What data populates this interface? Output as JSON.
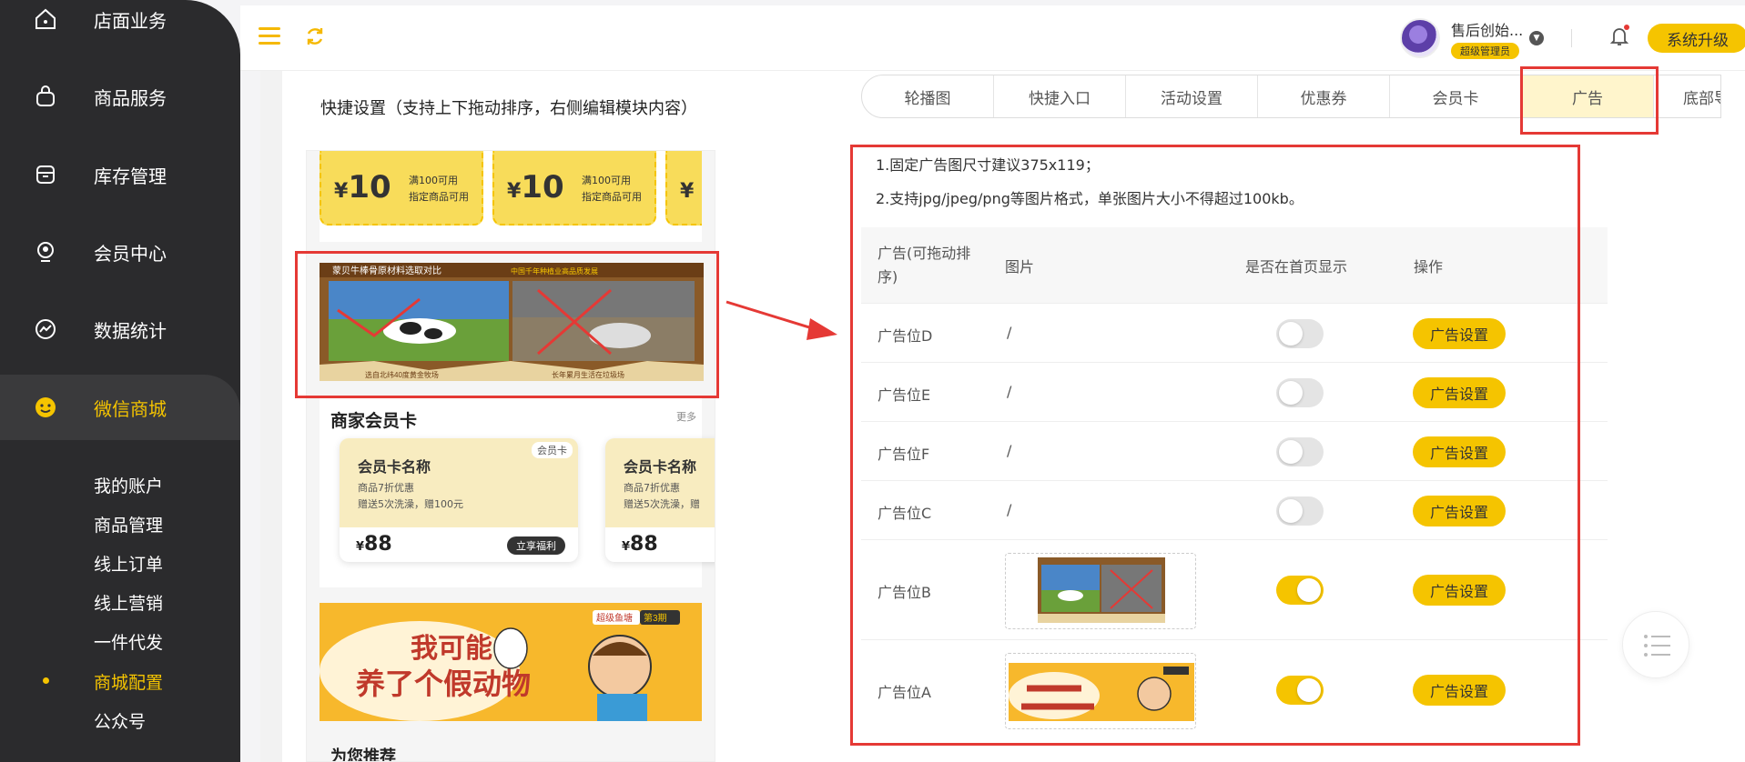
{
  "sidebar": {
    "items": [
      {
        "label": "店面业务",
        "icon": "home-icon"
      },
      {
        "label": "商品服务",
        "icon": "bag-icon"
      },
      {
        "label": "库存管理",
        "icon": "box-icon"
      },
      {
        "label": "会员中心",
        "icon": "member-icon"
      },
      {
        "label": "数据统计",
        "icon": "chart-icon"
      },
      {
        "label": "微信商城",
        "icon": "smile-icon",
        "active": true
      }
    ],
    "sub_items": [
      {
        "label": "我的账户"
      },
      {
        "label": "商品管理"
      },
      {
        "label": "线上订单"
      },
      {
        "label": "线上营销"
      },
      {
        "label": "一件代发"
      },
      {
        "label": "商城配置",
        "active": true
      },
      {
        "label": "公众号"
      }
    ]
  },
  "header": {
    "user_name": "售后创始...",
    "user_role": "超级管理员",
    "upgrade_label": "系统升级"
  },
  "preview": {
    "title": "快捷设置（支持上下拖动排序，右侧编辑模块内容）",
    "coupons": [
      {
        "symbol": "¥",
        "amount": "10",
        "line1": "满100可用",
        "line2": "指定商品可用"
      },
      {
        "symbol": "¥",
        "amount": "10",
        "line1": "满100可用",
        "line2": "指定商品可用"
      },
      {
        "symbol": "¥",
        "amount": "",
        "line1": "",
        "line2": ""
      }
    ],
    "ad_banner": {
      "title": "蒙贝牛棒骨原材料选取对比",
      "subtitle": "中国千年种植业高品质发展",
      "caption_left": "选自北纬40度黄金牧场",
      "caption_right": "长年累月生活在垃圾场"
    },
    "member_section": {
      "title": "商家会员卡",
      "more": "更多",
      "cards": [
        {
          "tag": "会员卡",
          "name": "会员卡名称",
          "line1": "商品7折优惠",
          "line2": "赠送5次洗澡，赠100元",
          "currency": "¥",
          "price": "88",
          "button": "立享福利"
        },
        {
          "tag": "",
          "name": "会员卡名称",
          "line1": "商品7折优惠",
          "line2": "赠送5次洗澡，赠",
          "currency": "¥",
          "price": "88",
          "button": ""
        }
      ]
    },
    "promo_banner": {
      "badge": "超级鱼塘",
      "issue": "第3期",
      "line1": "我可能",
      "line2": "养了个假动物"
    },
    "recommend_title": "为您推荐"
  },
  "tabs": {
    "items": [
      {
        "label": "轮播图"
      },
      {
        "label": "快捷入口"
      },
      {
        "label": "活动设置"
      },
      {
        "label": "优惠券"
      },
      {
        "label": "会员卡"
      },
      {
        "label": "广告",
        "active": true
      },
      {
        "label": "底部导"
      }
    ]
  },
  "notices": [
    "1.固定广告图尺寸建议375x119；",
    "2.支持jpg/jpeg/png等图片格式，单张图片大小不得超过100kb。"
  ],
  "table": {
    "headers": {
      "ad": "广告(可拖动排序)",
      "image": "图片",
      "show_home": "是否在首页显示",
      "action": "操作"
    },
    "rows": [
      {
        "name": "广告位D",
        "image": "/",
        "enabled": false,
        "button": "广告设置"
      },
      {
        "name": "广告位E",
        "image": "/",
        "enabled": false,
        "button": "广告设置"
      },
      {
        "name": "广告位F",
        "image": "/",
        "enabled": false,
        "button": "广告设置"
      },
      {
        "name": "广告位C",
        "image": "/",
        "enabled": false,
        "button": "广告设置"
      },
      {
        "name": "广告位B",
        "image": "cow-comparison-thumbnail",
        "enabled": true,
        "button": "广告设置"
      },
      {
        "name": "广告位A",
        "image": "fake-animal-promo-thumbnail",
        "enabled": true,
        "button": "广告设置"
      }
    ]
  },
  "colors": {
    "accent": "#f5c400",
    "sidebar_bg": "#2b2b2d",
    "highlight_red": "#e53935"
  }
}
